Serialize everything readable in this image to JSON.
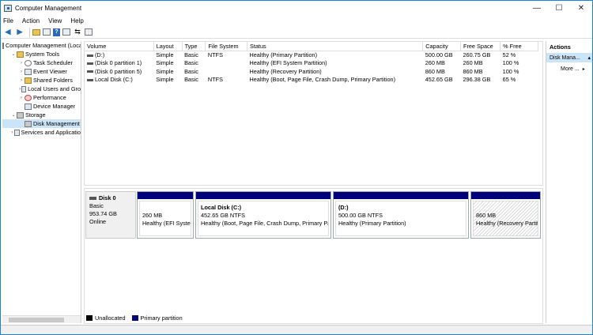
{
  "window": {
    "title": "Computer Management",
    "controls": {
      "minimize": "—",
      "maximize": "☐",
      "close": "✕"
    }
  },
  "menu": [
    "File",
    "Action",
    "View",
    "Help"
  ],
  "toolbar": {
    "icons": [
      "back-arrow-icon",
      "forward-arrow-icon",
      "up-folder-icon",
      "console-tree-icon",
      "help-icon",
      "properties-icon",
      "connect-icon",
      "view-icon"
    ]
  },
  "tree": {
    "items": [
      {
        "label": "Computer Management (Local",
        "exp": "",
        "indent": 0,
        "icon": "computer-icon"
      },
      {
        "label": "System Tools",
        "exp": "⌄",
        "indent": 1,
        "icon": "tools-icon"
      },
      {
        "label": "Task Scheduler",
        "exp": "›",
        "indent": 2,
        "icon": "clock-icon"
      },
      {
        "label": "Event Viewer",
        "exp": "›",
        "indent": 2,
        "icon": "event-viewer-icon"
      },
      {
        "label": "Shared Folders",
        "exp": "›",
        "indent": 2,
        "icon": "shared-folders-icon"
      },
      {
        "label": "Local Users and Gro",
        "exp": "›",
        "indent": 2,
        "icon": "users-icon"
      },
      {
        "label": "Performance",
        "exp": "›",
        "indent": 2,
        "icon": "performance-icon"
      },
      {
        "label": "Device Manager",
        "exp": "",
        "indent": 2,
        "icon": "device-manager-icon"
      },
      {
        "label": "Storage",
        "exp": "⌄",
        "indent": 1,
        "icon": "storage-icon"
      },
      {
        "label": "Disk Management",
        "exp": "",
        "indent": 2,
        "icon": "disk-management-icon",
        "selected": true
      },
      {
        "label": "Services and Applicatio",
        "exp": "›",
        "indent": 1,
        "icon": "services-icon"
      }
    ]
  },
  "volumes": {
    "columns": [
      "Volume",
      "Layout",
      "Type",
      "File System",
      "Status",
      "Capacity",
      "Free Space",
      "% Free"
    ],
    "rows": [
      [
        "(D:)",
        "Simple",
        "Basic",
        "NTFS",
        "Healthy (Primary Partition)",
        "500.00 GB",
        "260.75 GB",
        "52 %"
      ],
      [
        "(Disk 0 partition 1)",
        "Simple",
        "Basic",
        "",
        "Healthy (EFI System Partition)",
        "260 MB",
        "260 MB",
        "100 %"
      ],
      [
        "(Disk 0 partition 5)",
        "Simple",
        "Basic",
        "",
        "Healthy (Recovery Partition)",
        "860 MB",
        "860 MB",
        "100 %"
      ],
      [
        "Local Disk (C:)",
        "Simple",
        "Basic",
        "NTFS",
        "Healthy (Boot, Page File, Crash Dump, Primary Partition)",
        "452.65 GB",
        "296.38 GB",
        "65 %"
      ]
    ]
  },
  "disk": {
    "name": "Disk 0",
    "type": "Basic",
    "size": "953.74 GB",
    "status": "Online",
    "partitions": [
      {
        "title": "",
        "line1": "260 MB",
        "line2": "Healthy (EFI System",
        "hatched": false
      },
      {
        "title": "Local Disk  (C:)",
        "line1": "452.65 GB NTFS",
        "line2": "Healthy (Boot, Page File, Crash Dump, Primary Parti",
        "hatched": false
      },
      {
        "title": "(D:)",
        "line1": "500.00 GB NTFS",
        "line2": "Healthy (Primary Partition)",
        "hatched": false
      },
      {
        "title": "",
        "line1": "860 MB",
        "line2": "Healthy (Recovery Partiti",
        "hatched": true
      }
    ]
  },
  "legend": [
    {
      "label": "Unallocated",
      "color": "#000000"
    },
    {
      "label": "Primary partition",
      "color": "#00007a"
    }
  ],
  "actions": {
    "header": "Actions",
    "section": "Disk Mana...",
    "more": "More ..."
  }
}
